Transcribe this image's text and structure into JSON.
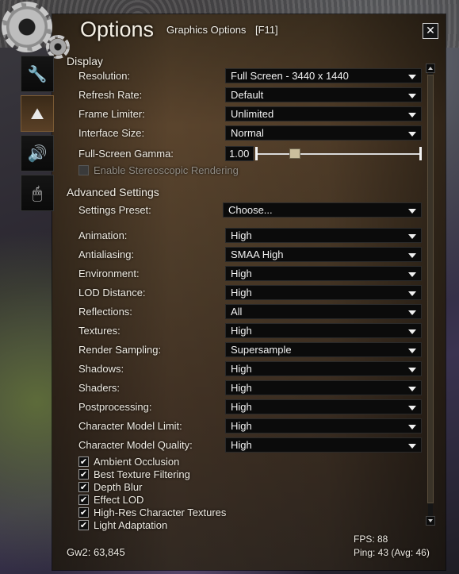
{
  "window": {
    "title": "Options",
    "subtitle": "Graphics Options",
    "hotkey": "[F11]",
    "close_label": "✕"
  },
  "sidebar": {
    "tabs": [
      {
        "icon": "wrench-icon",
        "glyph": "🔧",
        "active": false
      },
      {
        "icon": "mountains-icon",
        "glyph": "⛰",
        "active": true
      },
      {
        "icon": "speaker-icon",
        "glyph": "🔊",
        "active": false
      },
      {
        "icon": "mouse-icon",
        "glyph": "🖱",
        "active": false
      }
    ]
  },
  "display": {
    "heading": "Display",
    "resolution": {
      "label": "Resolution:",
      "value": "Full Screen - 3440 x 1440"
    },
    "refresh_rate": {
      "label": "Refresh Rate:",
      "value": "Default"
    },
    "frame_limiter": {
      "label": "Frame Limiter:",
      "value": "Unlimited"
    },
    "interface_size": {
      "label": "Interface Size:",
      "value": "Normal"
    },
    "gamma": {
      "label": "Full-Screen Gamma:",
      "value": "1.00",
      "slider_fraction": 0.2
    },
    "stereoscopic": {
      "label": "Enable Stereoscopic Rendering",
      "checked": false,
      "disabled": true
    }
  },
  "advanced": {
    "heading": "Advanced Settings",
    "preset": {
      "label": "Settings Preset:",
      "value": "Choose..."
    },
    "settings": [
      {
        "label": "Animation:",
        "value": "High"
      },
      {
        "label": "Antialiasing:",
        "value": "SMAA High"
      },
      {
        "label": "Environment:",
        "value": "High"
      },
      {
        "label": "LOD Distance:",
        "value": "High"
      },
      {
        "label": "Reflections:",
        "value": "All"
      },
      {
        "label": "Textures:",
        "value": "High"
      },
      {
        "label": "Render Sampling:",
        "value": "Supersample"
      },
      {
        "label": "Shadows:",
        "value": "High"
      },
      {
        "label": "Shaders:",
        "value": "High"
      },
      {
        "label": "Postprocessing:",
        "value": "High"
      },
      {
        "label": "Character Model Limit:",
        "value": "High"
      },
      {
        "label": "Character Model Quality:",
        "value": "High"
      }
    ],
    "checkboxes": [
      {
        "label": "Ambient Occlusion",
        "checked": true
      },
      {
        "label": "Best Texture Filtering",
        "checked": true
      },
      {
        "label": "Depth Blur",
        "checked": true
      },
      {
        "label": "Effect LOD",
        "checked": true
      },
      {
        "label": "High-Res Character Textures",
        "checked": true
      },
      {
        "label": "Light Adaptation",
        "checked": true
      }
    ],
    "checkmark": "✔"
  },
  "footer": {
    "gw2": "Gw2: 63,845",
    "fps": "FPS: 88",
    "ping": "Ping: 43 (Avg: 46)"
  }
}
